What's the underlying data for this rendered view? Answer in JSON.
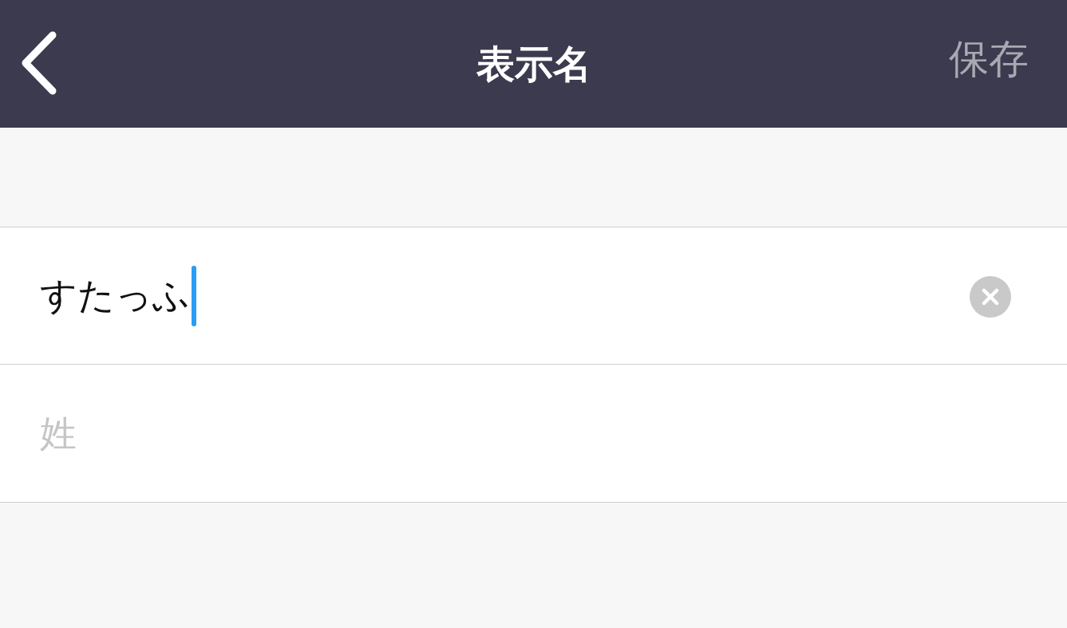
{
  "header": {
    "title": "表示名",
    "save_button": {
      "label": "保存",
      "disabled": true
    }
  },
  "fields": [
    {
      "value": "すたっふ",
      "focused": true
    },
    {
      "placeholder": "姓",
      "focused": false
    }
  ]
}
